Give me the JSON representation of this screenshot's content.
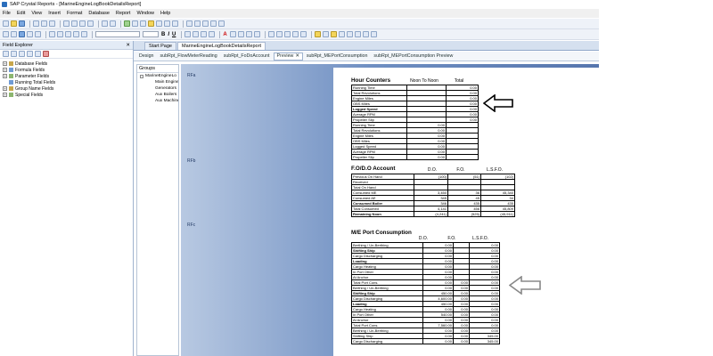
{
  "window": {
    "title": "SAP Crystal Reports - [MarineEngineLogBookDetailsReport]"
  },
  "menu": [
    "File",
    "Edit",
    "View",
    "Insert",
    "Format",
    "Database",
    "Report",
    "Window",
    "Help"
  ],
  "field_explorer": {
    "title": "Field Explorer",
    "close_glyph": "✕",
    "items": [
      {
        "label": "Database Fields"
      },
      {
        "label": "Formula Fields"
      },
      {
        "label": "Parameter Fields"
      },
      {
        "label": "Running Total Fields"
      },
      {
        "label": "Group Name Fields"
      },
      {
        "label": "Special Fields"
      }
    ]
  },
  "doc_tabs": [
    {
      "label": "Start Page"
    },
    {
      "label": "MarineEngineLogBookDetailsReport",
      "active": true
    }
  ],
  "sub_tabs": [
    {
      "label": "Design"
    },
    {
      "label": "subRpt_FlowMeterReading"
    },
    {
      "label": "subRpt_FoDoAccount"
    },
    {
      "label": "Preview",
      "active": true
    },
    {
      "label": "subRpt_MEPortConsumption"
    },
    {
      "label": "subRpt_MEPortConsumption Preview"
    }
  ],
  "group_tree": {
    "title": "Groups",
    "root": "MarineEngineLo",
    "children": [
      "Main Engine",
      "Generators",
      "Aux Boilers",
      "Aux Machinery"
    ]
  },
  "section_labels": [
    "RFa",
    "RFb",
    "RFc"
  ],
  "hour_counters": {
    "title": "Hour Counters",
    "headers": [
      "Noon To Noon",
      "Total"
    ],
    "rows": [
      [
        "Running Time",
        "",
        "0.00"
      ],
      [
        "Total Revolutions",
        "",
        "0.00"
      ],
      [
        "Engine Miles",
        "",
        "0.00"
      ],
      [
        "OBS Miles",
        "",
        "0.00"
      ],
      [
        "Logged Speed",
        "",
        "0.00"
      ],
      [
        "Average RPM",
        "",
        "0.00"
      ],
      [
        "Propeller Slip",
        "",
        "0.00"
      ],
      [
        "Running Time",
        "0.00",
        ""
      ],
      [
        "Total Revolutions",
        "0.00",
        ""
      ],
      [
        "Engine Miles",
        "0.00",
        ""
      ],
      [
        "OBS Miles",
        "0.00",
        ""
      ],
      [
        "Logged Speed",
        "0.00",
        ""
      ],
      [
        "Average RPM",
        "0.00",
        ""
      ],
      [
        "Propeller Slip",
        "0.00",
        ""
      ]
    ]
  },
  "fo_do_account": {
    "title": "F.O/D.O Account",
    "headers": [
      "D.O.",
      "F.O.",
      "L.S.F.O."
    ],
    "rows": [
      [
        "Previous On Hand",
        "(100)",
        "(51)",
        "(102)"
      ],
      [
        "Received",
        "",
        "",
        ""
      ],
      [
        "Total On Hand",
        "",
        "",
        ""
      ],
      [
        "Consumed ME",
        "3,450",
        "36",
        "45,340"
      ],
      [
        "Consumed AE",
        "345",
        "45",
        "34"
      ],
      [
        "Consumed Boiler",
        "346",
        "435",
        "435"
      ],
      [
        "Total Consumed",
        "4,141",
        "456",
        "45,809"
      ],
      [
        "Remaining Noon",
        "(4,241)",
        "(525)",
        "(45,911)"
      ]
    ]
  },
  "me_port_consumption": {
    "title": "M/E Port Consumption",
    "headers": [
      "D.O.",
      "F.O.",
      "L.S.F.O."
    ],
    "rows": [
      [
        "Berthing / Un-Berthing",
        "0.00",
        "",
        "0.00"
      ],
      [
        "Shifting Ship",
        "0.00",
        "",
        "0.00"
      ],
      [
        "Cargo Discharging",
        "0.00",
        "",
        "0.00"
      ],
      [
        "Loading",
        "0.00",
        "",
        "0.00"
      ],
      [
        "Cargo Heating",
        "0.00",
        "",
        "0.00"
      ],
      [
        "In Port Other",
        "0.00",
        "",
        "0.00"
      ],
      [
        "At Anchor",
        "0.00",
        "",
        "0.00"
      ],
      [
        "Total Port Cons.",
        "0.00",
        "0.00",
        "0.00"
      ],
      [
        "Berthing / Un-Berthing",
        "0.00",
        "0.00",
        "0.00"
      ],
      [
        "Shifting Ship",
        "450.00",
        "0.00",
        "0.00"
      ],
      [
        "Cargo Discharging",
        "4,600.00",
        "0.00",
        "0.00"
      ],
      [
        "Loading",
        "450.00",
        "0.00",
        "0.00"
      ],
      [
        "Cargo Heating",
        "0.00",
        "0.00",
        "0.00"
      ],
      [
        "In Port Other",
        "540.00",
        "0.00",
        "0.00"
      ],
      [
        "At Anchor",
        "0.00",
        "0.00",
        "0.00"
      ],
      [
        "Total Port Cons.",
        "7,560.00",
        "0.00",
        "0.00"
      ],
      [
        "Berthing / Un-Berthing",
        "0.00",
        "0.00",
        "0.00"
      ],
      [
        "Shifting Ship",
        "0.00",
        "0.00",
        "345.00"
      ],
      [
        "Cargo Discharging",
        "0.00",
        "0.00",
        "345.00"
      ]
    ]
  },
  "colors": {
    "arrow_black": "#000000",
    "arrow_gray": "#888888",
    "page_bg_blue": "#6f8fc2"
  }
}
